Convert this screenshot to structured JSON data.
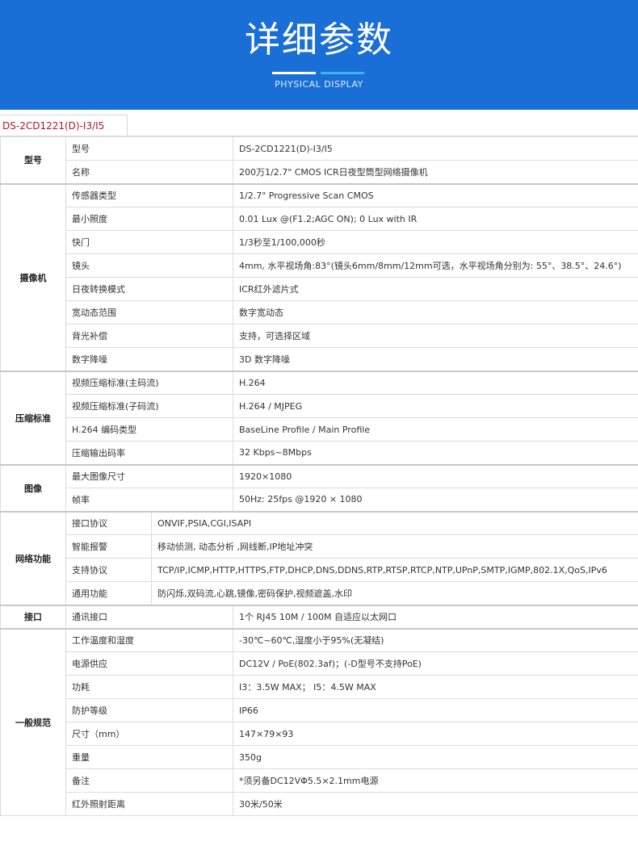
{
  "banner": {
    "title": "详细参数",
    "subtitle": "PHYSICAL DISPLAY"
  },
  "tab": {
    "label": "DS-2CD1221(D)-I3/I5"
  },
  "groups": [
    {
      "name": "型号",
      "rows": [
        {
          "label": "型号",
          "value": "DS-2CD1221(D)-I3/I5"
        },
        {
          "label": "名称",
          "value": "200万1/2.7\" CMOS ICR日夜型筒型网络摄像机"
        }
      ]
    },
    {
      "name": "摄像机",
      "rows": [
        {
          "label": "传感器类型",
          "value": "1/2.7\" Progressive Scan CMOS"
        },
        {
          "label": "最小照度",
          "value": "0.01 Lux @(F1.2;AGC ON); 0 Lux with IR"
        },
        {
          "label": "快门",
          "value": "1/3秒至1/100,000秒"
        },
        {
          "label": "镜头",
          "value": "4mm, 水平视场角:83°(镜头6mm/8mm/12mm可选，水平视场角分别为: 55°、38.5°、24.6°)"
        },
        {
          "label": "日夜转换模式",
          "value": "ICR红外滤片式"
        },
        {
          "label": "宽动态范围",
          "value": "数字宽动态"
        },
        {
          "label": "背光补偿",
          "value": "支持，可选择区域"
        },
        {
          "label": "数字降噪",
          "value": "3D 数字降噪"
        }
      ]
    },
    {
      "name": "压缩标准",
      "rows": [
        {
          "label": "视频压缩标准(主码流)",
          "value": "H.264"
        },
        {
          "label": "视频压缩标准(子码流)",
          "value": "H.264 / MJPEG"
        },
        {
          "label": "H.264 编码类型",
          "value": "BaseLine Profile / Main Profile"
        },
        {
          "label": "压缩输出码率",
          "value": "32 Kbps~8Mbps"
        }
      ]
    },
    {
      "name": "图像",
      "rows": [
        {
          "label": "最大图像尺寸",
          "value": "1920×1080"
        },
        {
          "label": "帧率",
          "value": "50Hz: 25fps @1920 × 1080"
        }
      ]
    },
    {
      "name": "网络功能",
      "narrow": true,
      "rows": [
        {
          "label": "接口协议",
          "value": "ONVIF,PSIA,CGI,ISAPI"
        },
        {
          "label": "智能报警",
          "value": "移动侦测, 动态分析 ,网线断,IP地址冲突"
        },
        {
          "label": "支持协议",
          "value": "TCP/IP,ICMP,HTTP,HTTPS,FTP,DHCP,DNS,DDNS,RTP,RTSP,RTCP,NTP,UPnP,SMTP,IGMP,802.1X,QoS,IPv6"
        },
        {
          "label": "通用功能",
          "value": "防闪烁,双码流,心跳,镜像,密码保护,视频遮盖,水印"
        }
      ]
    },
    {
      "name": "接口",
      "rows": [
        {
          "label": "通讯接口",
          "value": "1个 RJ45 10M / 100M 自适应以太网口"
        }
      ]
    },
    {
      "name": "一般规范",
      "rows": [
        {
          "label": "工作温度和湿度",
          "value": "-30℃~60℃,湿度小于95%(无凝结)"
        },
        {
          "label": "电源供应",
          "value": "DC12V / PoE(802.3af)；(-D型号不支持PoE)"
        },
        {
          "label": "功耗",
          "value": "I3：3.5W MAX； I5：4.5W MAX"
        },
        {
          "label": "防护等级",
          "value": "IP66"
        },
        {
          "label": "尺寸（mm）",
          "value": "147×79×93"
        },
        {
          "label": "重量",
          "value": "350g"
        },
        {
          "label": "备注",
          "value": "*须另备DC12VΦ5.5×2.1mm电源"
        },
        {
          "label": "红外照射距离",
          "value": "30米/50米"
        }
      ]
    }
  ]
}
